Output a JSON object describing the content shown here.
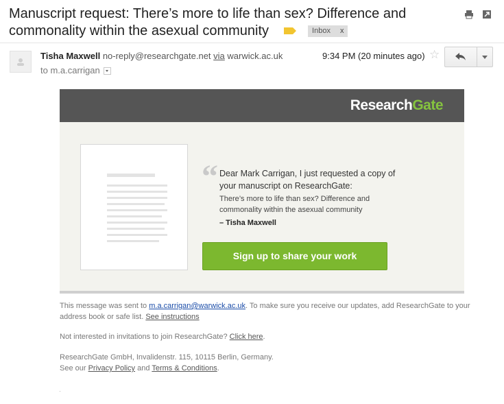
{
  "subject": "Manuscript request: There’s more to life than sex? Difference and commonality within the asexual community",
  "labels": {
    "inbox": "Inbox",
    "remove": "x"
  },
  "sender": {
    "name": "Tisha Maxwell",
    "email": "no-reply@researchgate.net",
    "via_label": "via",
    "via_domain": "warwick.ac.uk",
    "to_prefix": "to",
    "recipient": "m.a.carrigan"
  },
  "timestamp": "9:34 PM (20 minutes ago)",
  "icons": [
    "print-icon",
    "new-window-icon",
    "avatar-icon",
    "star-icon",
    "reply-icon",
    "more-options-icon",
    "quote-icon"
  ],
  "email_body": {
    "logo_research": "Research",
    "logo_gate": "Gate",
    "message": "Dear Mark Carrigan, I just requested a copy of your manuscript on ResearchGate:",
    "paper_title": "There’s more to life than sex? Difference and commonality within the asexual community",
    "signature": "– Tisha Maxwell",
    "cta": "Sign up to share your work"
  },
  "footer": {
    "sent_prefix": "This message was sent to ",
    "sent_email": "m.a.carrigan@warwick.ac.uk",
    "sent_suffix": ". To make sure you receive our updates, add ResearchGate to your address book or safe list. ",
    "see_instructions": "See instructions",
    "not_interested": "Not interested in invitations to join ResearchGate? ",
    "click_here": "Click here",
    "period": ".",
    "address": "ResearchGate GmbH, Invalidenstr. 115, 10115 Berlin, Germany.",
    "see_our": "See our ",
    "privacy": "Privacy Policy",
    "and": " and ",
    "terms": "Terms & Conditions",
    "end": "."
  },
  "colors": {
    "brand_green": "#7cb82f",
    "logo_gate": "#85c33f",
    "header_gray": "#555555",
    "label_yellow": "#f2c530"
  }
}
